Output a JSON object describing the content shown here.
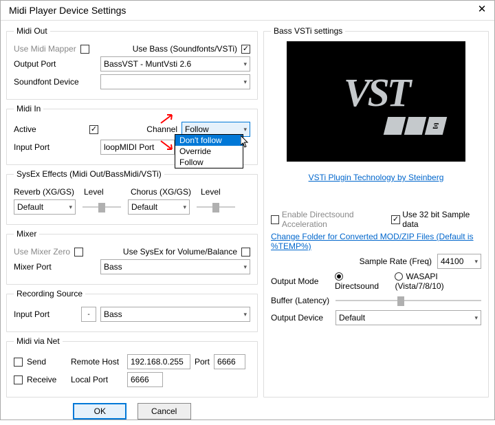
{
  "window_title": "Midi Player Device Settings",
  "midi_out": {
    "legend": "Midi Out",
    "use_midi_mapper_label": "Use Midi Mapper",
    "use_midi_mapper_checked": false,
    "use_bass_label": "Use Bass (Soundfonts/VSTi)",
    "use_bass_checked": true,
    "output_port_label": "Output Port",
    "output_port_value": "BassVST - MuntVsti 2.6",
    "soundfont_label": "Soundfont Device",
    "soundfont_value": ""
  },
  "midi_in": {
    "legend": "Midi In",
    "active_label": "Active",
    "active_checked": true,
    "channel_label": "Channel",
    "channel_value": "Follow",
    "channel_options": [
      "Don't follow",
      "Override",
      "Follow"
    ],
    "channel_highlighted": "Don't follow",
    "input_port_label": "Input Port",
    "input_port_value": "loopMIDI Port"
  },
  "sysex": {
    "legend": "SysEx Effects (Midi Out/BassMidi/VSTi)",
    "reverb_label": "Reverb (XG/GS)",
    "reverb_value": "Default",
    "level_label": "Level",
    "chorus_label": "Chorus (XG/GS)",
    "chorus_value": "Default"
  },
  "mixer": {
    "legend": "Mixer",
    "use_mixer_zero_label": "Use Mixer Zero",
    "use_sysex_label": "Use SysEx for Volume/Balance",
    "mixer_port_label": "Mixer Port",
    "mixer_port_value": "Bass"
  },
  "recording": {
    "legend": "Recording Source",
    "input_port_label": "Input Port",
    "small_value": "-",
    "combo_value": "Bass"
  },
  "midi_net": {
    "legend": "Midi via Net",
    "send_label": "Send",
    "receive_label": "Receive",
    "remote_host_label": "Remote Host",
    "remote_host_value": "192.168.0.255",
    "port_label": "Port",
    "port_value": "6666",
    "local_port_label": "Local Port",
    "local_port_value": "6666"
  },
  "bass_vsti": {
    "legend": "Bass VSTi settings",
    "link_text": "VSTi Plugin Technology by Steinberg",
    "enable_ds_label": "Enable Directsound Acceleration",
    "enable_ds_checked": false,
    "use_32bit_label": "Use 32 bit Sample data",
    "use_32bit_checked": true,
    "change_folder_link": "Change Folder for Converted MOD/ZIP Files (Default is %TEMP%)",
    "sample_rate_label": "Sample Rate (Freq)",
    "sample_rate_value": "44100",
    "output_mode_label": "Output Mode",
    "directsound_label": "Directsound",
    "wasapi_label": "WASAPI (Vista/7/8/10)",
    "output_mode_selected": "Directsound",
    "buffer_label": "Buffer (Latency)",
    "output_device_label": "Output Device",
    "output_device_value": "Default"
  },
  "buttons": {
    "ok": "OK",
    "cancel": "Cancel"
  }
}
